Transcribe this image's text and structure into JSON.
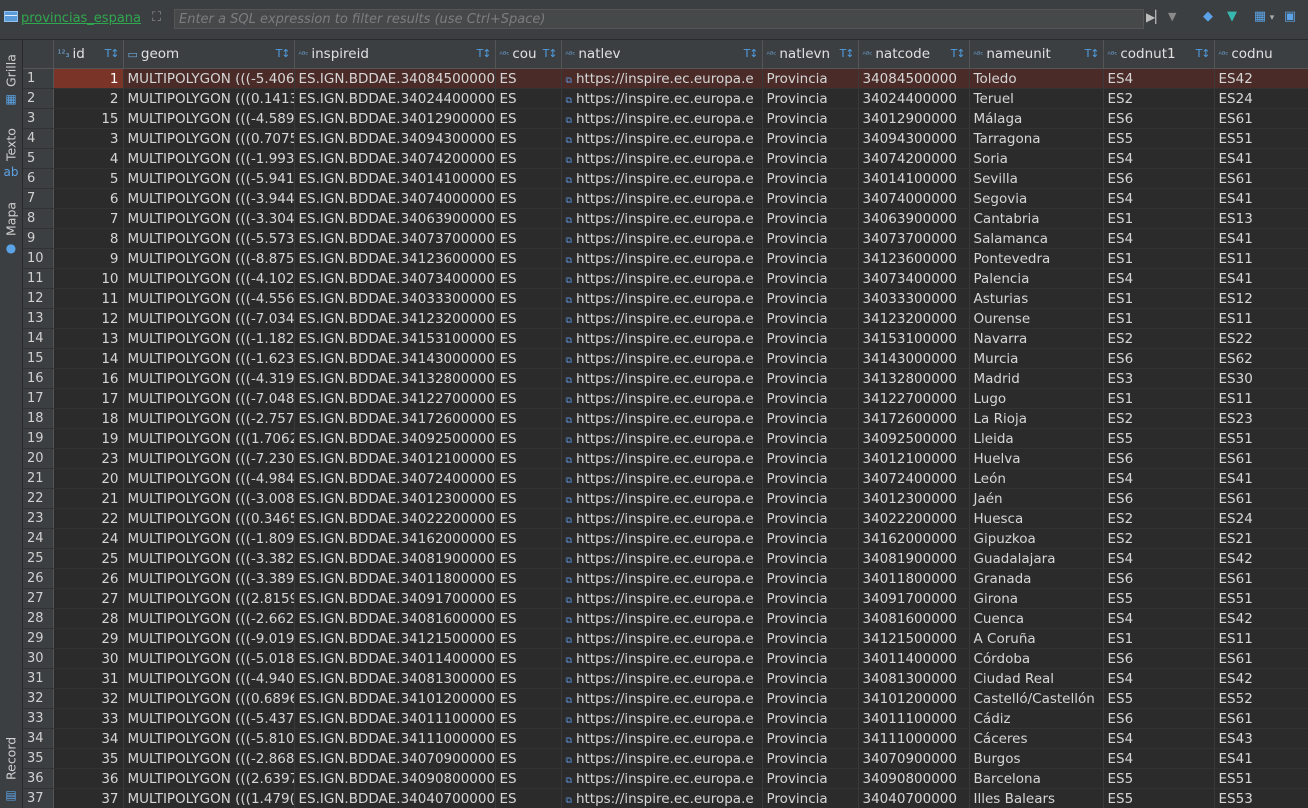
{
  "toolbar": {
    "table_name": "provincias_espana",
    "filter_placeholder": "Enter a SQL expression to filter results (use Ctrl+Space)"
  },
  "side_tabs": {
    "grid": "Grilla",
    "text": "Texto",
    "map": "Mapa",
    "record": "Record"
  },
  "columns": [
    "id",
    "geom",
    "inspireid",
    "cou",
    "natlev",
    "natlevn",
    "natcode",
    "nameunit",
    "codnut1",
    "codnu"
  ],
  "rows": [
    {
      "n": "1",
      "id": "1",
      "geom": "MULTIPOLYGON (((-5.406",
      "inspireid": "ES.IGN.BDDAE.34084500000",
      "cou": "ES",
      "natlev": "https://inspire.ec.europa.e",
      "natlevn": "Provincia",
      "natcode": "34084500000",
      "nameunit": "Toledo",
      "codnut1": "ES4",
      "codnut2": "ES42"
    },
    {
      "n": "2",
      "id": "2",
      "geom": "MULTIPOLYGON (((0.1413",
      "inspireid": "ES.IGN.BDDAE.34024400000",
      "cou": "ES",
      "natlev": "https://inspire.ec.europa.e",
      "natlevn": "Provincia",
      "natcode": "34024400000",
      "nameunit": "Teruel",
      "codnut1": "ES2",
      "codnut2": "ES24"
    },
    {
      "n": "3",
      "id": "15",
      "geom": "MULTIPOLYGON (((-4.589",
      "inspireid": "ES.IGN.BDDAE.34012900000",
      "cou": "ES",
      "natlev": "https://inspire.ec.europa.e",
      "natlevn": "Provincia",
      "natcode": "34012900000",
      "nameunit": "Málaga",
      "codnut1": "ES6",
      "codnut2": "ES61"
    },
    {
      "n": "4",
      "id": "3",
      "geom": "MULTIPOLYGON (((0.7075",
      "inspireid": "ES.IGN.BDDAE.34094300000",
      "cou": "ES",
      "natlev": "https://inspire.ec.europa.e",
      "natlevn": "Provincia",
      "natcode": "34094300000",
      "nameunit": "Tarragona",
      "codnut1": "ES5",
      "codnut2": "ES51"
    },
    {
      "n": "5",
      "id": "4",
      "geom": "MULTIPOLYGON (((-1.993",
      "inspireid": "ES.IGN.BDDAE.34074200000",
      "cou": "ES",
      "natlev": "https://inspire.ec.europa.e",
      "natlevn": "Provincia",
      "natcode": "34074200000",
      "nameunit": "Soria",
      "codnut1": "ES4",
      "codnut2": "ES41"
    },
    {
      "n": "6",
      "id": "5",
      "geom": "MULTIPOLYGON (((-5.941",
      "inspireid": "ES.IGN.BDDAE.34014100000",
      "cou": "ES",
      "natlev": "https://inspire.ec.europa.e",
      "natlevn": "Provincia",
      "natcode": "34014100000",
      "nameunit": "Sevilla",
      "codnut1": "ES6",
      "codnut2": "ES61"
    },
    {
      "n": "7",
      "id": "6",
      "geom": "MULTIPOLYGON (((-3.944",
      "inspireid": "ES.IGN.BDDAE.34074000000",
      "cou": "ES",
      "natlev": "https://inspire.ec.europa.e",
      "natlevn": "Provincia",
      "natcode": "34074000000",
      "nameunit": "Segovia",
      "codnut1": "ES4",
      "codnut2": "ES41"
    },
    {
      "n": "8",
      "id": "7",
      "geom": "MULTIPOLYGON (((-3.304",
      "inspireid": "ES.IGN.BDDAE.34063900000",
      "cou": "ES",
      "natlev": "https://inspire.ec.europa.e",
      "natlevn": "Provincia",
      "natcode": "34063900000",
      "nameunit": "Cantabria",
      "codnut1": "ES1",
      "codnut2": "ES13"
    },
    {
      "n": "9",
      "id": "8",
      "geom": "MULTIPOLYGON (((-5.573",
      "inspireid": "ES.IGN.BDDAE.34073700000",
      "cou": "ES",
      "natlev": "https://inspire.ec.europa.e",
      "natlevn": "Provincia",
      "natcode": "34073700000",
      "nameunit": "Salamanca",
      "codnut1": "ES4",
      "codnut2": "ES41"
    },
    {
      "n": "10",
      "id": "9",
      "geom": "MULTIPOLYGON (((-8.875",
      "inspireid": "ES.IGN.BDDAE.34123600000",
      "cou": "ES",
      "natlev": "https://inspire.ec.europa.e",
      "natlevn": "Provincia",
      "natcode": "34123600000",
      "nameunit": "Pontevedra",
      "codnut1": "ES1",
      "codnut2": "ES11"
    },
    {
      "n": "11",
      "id": "10",
      "geom": "MULTIPOLYGON (((-4.102",
      "inspireid": "ES.IGN.BDDAE.34073400000",
      "cou": "ES",
      "natlev": "https://inspire.ec.europa.e",
      "natlevn": "Provincia",
      "natcode": "34073400000",
      "nameunit": "Palencia",
      "codnut1": "ES4",
      "codnut2": "ES41"
    },
    {
      "n": "12",
      "id": "11",
      "geom": "MULTIPOLYGON (((-4.556",
      "inspireid": "ES.IGN.BDDAE.34033300000",
      "cou": "ES",
      "natlev": "https://inspire.ec.europa.e",
      "natlevn": "Provincia",
      "natcode": "34033300000",
      "nameunit": "Asturias",
      "codnut1": "ES1",
      "codnut2": "ES12"
    },
    {
      "n": "13",
      "id": "12",
      "geom": "MULTIPOLYGON (((-7.034",
      "inspireid": "ES.IGN.BDDAE.34123200000",
      "cou": "ES",
      "natlev": "https://inspire.ec.europa.e",
      "natlevn": "Provincia",
      "natcode": "34123200000",
      "nameunit": "Ourense",
      "codnut1": "ES1",
      "codnut2": "ES11"
    },
    {
      "n": "14",
      "id": "13",
      "geom": "MULTIPOLYGON (((-1.182",
      "inspireid": "ES.IGN.BDDAE.34153100000",
      "cou": "ES",
      "natlev": "https://inspire.ec.europa.e",
      "natlevn": "Provincia",
      "natcode": "34153100000",
      "nameunit": "Navarra",
      "codnut1": "ES2",
      "codnut2": "ES22"
    },
    {
      "n": "15",
      "id": "14",
      "geom": "MULTIPOLYGON (((-1.623",
      "inspireid": "ES.IGN.BDDAE.34143000000",
      "cou": "ES",
      "natlev": "https://inspire.ec.europa.e",
      "natlevn": "Provincia",
      "natcode": "34143000000",
      "nameunit": "Murcia",
      "codnut1": "ES6",
      "codnut2": "ES62"
    },
    {
      "n": "16",
      "id": "16",
      "geom": "MULTIPOLYGON (((-4.319",
      "inspireid": "ES.IGN.BDDAE.34132800000",
      "cou": "ES",
      "natlev": "https://inspire.ec.europa.e",
      "natlevn": "Provincia",
      "natcode": "34132800000",
      "nameunit": "Madrid",
      "codnut1": "ES3",
      "codnut2": "ES30"
    },
    {
      "n": "17",
      "id": "17",
      "geom": "MULTIPOLYGON (((-7.048",
      "inspireid": "ES.IGN.BDDAE.34122700000",
      "cou": "ES",
      "natlev": "https://inspire.ec.europa.e",
      "natlevn": "Provincia",
      "natcode": "34122700000",
      "nameunit": "Lugo",
      "codnut1": "ES1",
      "codnut2": "ES11"
    },
    {
      "n": "18",
      "id": "18",
      "geom": "MULTIPOLYGON (((-2.757",
      "inspireid": "ES.IGN.BDDAE.34172600000",
      "cou": "ES",
      "natlev": "https://inspire.ec.europa.e",
      "natlevn": "Provincia",
      "natcode": "34172600000",
      "nameunit": "La Rioja",
      "codnut1": "ES2",
      "codnut2": "ES23"
    },
    {
      "n": "19",
      "id": "19",
      "geom": "MULTIPOLYGON (((1.7062",
      "inspireid": "ES.IGN.BDDAE.34092500000",
      "cou": "ES",
      "natlev": "https://inspire.ec.europa.e",
      "natlevn": "Provincia",
      "natcode": "34092500000",
      "nameunit": "Lleida",
      "codnut1": "ES5",
      "codnut2": "ES51"
    },
    {
      "n": "20",
      "id": "23",
      "geom": "MULTIPOLYGON (((-7.230",
      "inspireid": "ES.IGN.BDDAE.34012100000",
      "cou": "ES",
      "natlev": "https://inspire.ec.europa.e",
      "natlevn": "Provincia",
      "natcode": "34012100000",
      "nameunit": "Huelva",
      "codnut1": "ES6",
      "codnut2": "ES61"
    },
    {
      "n": "21",
      "id": "20",
      "geom": "MULTIPOLYGON (((-4.984",
      "inspireid": "ES.IGN.BDDAE.34072400000",
      "cou": "ES",
      "natlev": "https://inspire.ec.europa.e",
      "natlevn": "Provincia",
      "natcode": "34072400000",
      "nameunit": "León",
      "codnut1": "ES4",
      "codnut2": "ES41"
    },
    {
      "n": "22",
      "id": "21",
      "geom": "MULTIPOLYGON (((-3.008",
      "inspireid": "ES.IGN.BDDAE.34012300000",
      "cou": "ES",
      "natlev": "https://inspire.ec.europa.e",
      "natlevn": "Provincia",
      "natcode": "34012300000",
      "nameunit": "Jaén",
      "codnut1": "ES6",
      "codnut2": "ES61"
    },
    {
      "n": "23",
      "id": "22",
      "geom": "MULTIPOLYGON (((0.3465",
      "inspireid": "ES.IGN.BDDAE.34022200000",
      "cou": "ES",
      "natlev": "https://inspire.ec.europa.e",
      "natlevn": "Provincia",
      "natcode": "34022200000",
      "nameunit": "Huesca",
      "codnut1": "ES2",
      "codnut2": "ES24"
    },
    {
      "n": "24",
      "id": "24",
      "geom": "MULTIPOLYGON (((-1.809",
      "inspireid": "ES.IGN.BDDAE.34162000000",
      "cou": "ES",
      "natlev": "https://inspire.ec.europa.e",
      "natlevn": "Provincia",
      "natcode": "34162000000",
      "nameunit": "Gipuzkoa",
      "codnut1": "ES2",
      "codnut2": "ES21"
    },
    {
      "n": "25",
      "id": "25",
      "geom": "MULTIPOLYGON (((-3.382",
      "inspireid": "ES.IGN.BDDAE.34081900000",
      "cou": "ES",
      "natlev": "https://inspire.ec.europa.e",
      "natlevn": "Provincia",
      "natcode": "34081900000",
      "nameunit": "Guadalajara",
      "codnut1": "ES4",
      "codnut2": "ES42"
    },
    {
      "n": "26",
      "id": "26",
      "geom": "MULTIPOLYGON (((-3.389",
      "inspireid": "ES.IGN.BDDAE.34011800000",
      "cou": "ES",
      "natlev": "https://inspire.ec.europa.e",
      "natlevn": "Provincia",
      "natcode": "34011800000",
      "nameunit": "Granada",
      "codnut1": "ES6",
      "codnut2": "ES61"
    },
    {
      "n": "27",
      "id": "27",
      "geom": "MULTIPOLYGON (((2.8159",
      "inspireid": "ES.IGN.BDDAE.34091700000",
      "cou": "ES",
      "natlev": "https://inspire.ec.europa.e",
      "natlevn": "Provincia",
      "natcode": "34091700000",
      "nameunit": "Girona",
      "codnut1": "ES5",
      "codnut2": "ES51"
    },
    {
      "n": "28",
      "id": "28",
      "geom": "MULTIPOLYGON (((-2.662",
      "inspireid": "ES.IGN.BDDAE.34081600000",
      "cou": "ES",
      "natlev": "https://inspire.ec.europa.e",
      "natlevn": "Provincia",
      "natcode": "34081600000",
      "nameunit": "Cuenca",
      "codnut1": "ES4",
      "codnut2": "ES42"
    },
    {
      "n": "29",
      "id": "29",
      "geom": "MULTIPOLYGON (((-9.019",
      "inspireid": "ES.IGN.BDDAE.34121500000",
      "cou": "ES",
      "natlev": "https://inspire.ec.europa.e",
      "natlevn": "Provincia",
      "natcode": "34121500000",
      "nameunit": "A Coruña",
      "codnut1": "ES1",
      "codnut2": "ES11"
    },
    {
      "n": "30",
      "id": "30",
      "geom": "MULTIPOLYGON (((-5.018",
      "inspireid": "ES.IGN.BDDAE.34011400000",
      "cou": "ES",
      "natlev": "https://inspire.ec.europa.e",
      "natlevn": "Provincia",
      "natcode": "34011400000",
      "nameunit": "Córdoba",
      "codnut1": "ES6",
      "codnut2": "ES61"
    },
    {
      "n": "31",
      "id": "31",
      "geom": "MULTIPOLYGON (((-4.940",
      "inspireid": "ES.IGN.BDDAE.34081300000",
      "cou": "ES",
      "natlev": "https://inspire.ec.europa.e",
      "natlevn": "Provincia",
      "natcode": "34081300000",
      "nameunit": "Ciudad Real",
      "codnut1": "ES4",
      "codnut2": "ES42"
    },
    {
      "n": "32",
      "id": "32",
      "geom": "MULTIPOLYGON (((0.6896",
      "inspireid": "ES.IGN.BDDAE.34101200000",
      "cou": "ES",
      "natlev": "https://inspire.ec.europa.e",
      "natlevn": "Provincia",
      "natcode": "34101200000",
      "nameunit": "Castelló/Castellón",
      "codnut1": "ES5",
      "codnut2": "ES52"
    },
    {
      "n": "33",
      "id": "33",
      "geom": "MULTIPOLYGON (((-5.437",
      "inspireid": "ES.IGN.BDDAE.34011100000",
      "cou": "ES",
      "natlev": "https://inspire.ec.europa.e",
      "natlevn": "Provincia",
      "natcode": "34011100000",
      "nameunit": "Cádiz",
      "codnut1": "ES6",
      "codnut2": "ES61"
    },
    {
      "n": "34",
      "id": "34",
      "geom": "MULTIPOLYGON (((-5.810",
      "inspireid": "ES.IGN.BDDAE.34111000000",
      "cou": "ES",
      "natlev": "https://inspire.ec.europa.e",
      "natlevn": "Provincia",
      "natcode": "34111000000",
      "nameunit": "Cáceres",
      "codnut1": "ES4",
      "codnut2": "ES43"
    },
    {
      "n": "35",
      "id": "35",
      "geom": "MULTIPOLYGON (((-2.868",
      "inspireid": "ES.IGN.BDDAE.34070900000",
      "cou": "ES",
      "natlev": "https://inspire.ec.europa.e",
      "natlevn": "Provincia",
      "natcode": "34070900000",
      "nameunit": "Burgos",
      "codnut1": "ES4",
      "codnut2": "ES41"
    },
    {
      "n": "36",
      "id": "36",
      "geom": "MULTIPOLYGON (((2.6397",
      "inspireid": "ES.IGN.BDDAE.34090800000",
      "cou": "ES",
      "natlev": "https://inspire.ec.europa.e",
      "natlevn": "Provincia",
      "natcode": "34090800000",
      "nameunit": "Barcelona",
      "codnut1": "ES5",
      "codnut2": "ES51"
    },
    {
      "n": "37",
      "id": "37",
      "geom": "MULTIPOLYGON (((1.479(",
      "inspireid": "ES.IGN.BDDAE.34040700000",
      "cou": "ES",
      "natlev": "https://inspire.ec.europa.e",
      "natlevn": "Provincia",
      "natcode": "34040700000",
      "nameunit": "Illes Balears",
      "codnut1": "ES5",
      "codnut2": "ES53"
    }
  ],
  "colors": {
    "accent": "#4f9de0",
    "table_name": "#2fa84f",
    "selected_row": "#4a2b28",
    "selected_cell": "#7a3528"
  }
}
